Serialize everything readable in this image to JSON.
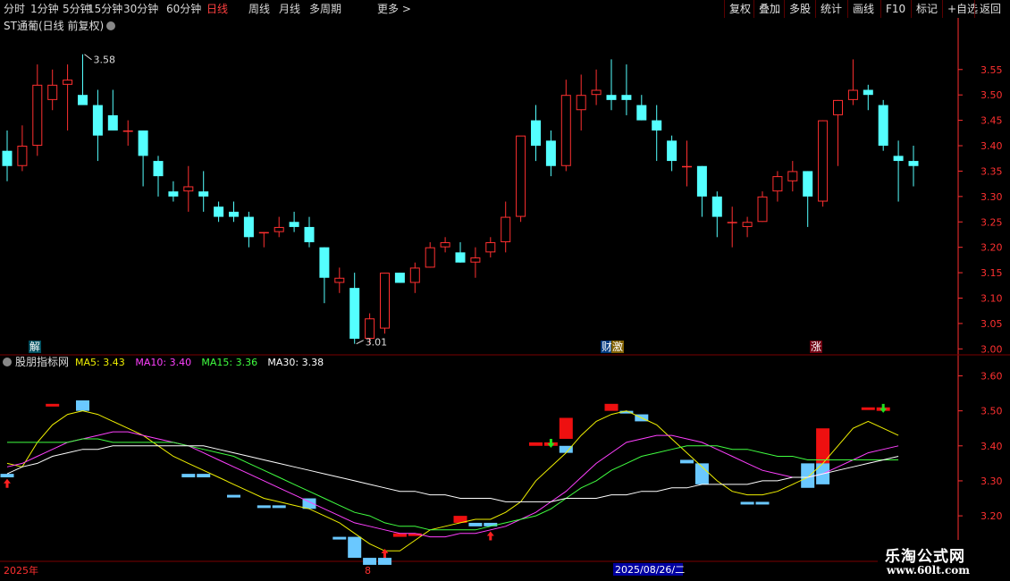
{
  "toolbar": {
    "periods": [
      "分时",
      "1分钟",
      "5分钟",
      "15分钟",
      "30分钟",
      "60分钟",
      "日线",
      "周线",
      "月线",
      "多周期",
      "更多 >"
    ],
    "active_period": "日线",
    "right_buttons": [
      "复权",
      "叠加",
      "多股",
      "统计",
      "画线",
      "F10",
      "标记",
      "+自选",
      "返回"
    ]
  },
  "main_panel": {
    "title": "ST通葡(日线 前复权)",
    "high_label": "3.58",
    "low_label": "3.01",
    "markers": [
      "解",
      "财",
      "激",
      "涨"
    ]
  },
  "indicator_panel": {
    "name": "股朋指标网",
    "ma": [
      {
        "label": "MA5:",
        "value": "3.43",
        "color": "#f0f000"
      },
      {
        "label": "MA10:",
        "value": "3.40",
        "color": "#ff40ff"
      },
      {
        "label": "MA15:",
        "value": "3.36",
        "color": "#40ff40"
      },
      {
        "label": "MA30:",
        "value": "3.38",
        "color": "#ffffff"
      }
    ]
  },
  "bottom_bar": {
    "left_label": "2025年",
    "month_label": "8",
    "date_label": "2025/08/26/二"
  },
  "watermark": {
    "title": "乐淘公式网",
    "url": "www.60lt.com"
  },
  "colors": {
    "up": "#ff3030",
    "down": "#54ffff",
    "grid": "#7a0000",
    "axis": "#ff3030"
  },
  "chart_data": [
    {
      "type": "candlestick",
      "title": "ST通葡(日线 前复权)",
      "ylim": [
        2.99,
        3.62
      ],
      "yticks": [
        3.0,
        3.05,
        3.1,
        3.15,
        3.2,
        3.25,
        3.3,
        3.35,
        3.4,
        3.45,
        3.5,
        3.55
      ],
      "annotations": [
        {
          "label": "3.58",
          "value": 3.58
        },
        {
          "label": "3.01",
          "value": 3.01
        }
      ],
      "ohlc": [
        [
          3.39,
          3.43,
          3.33,
          3.36
        ],
        [
          3.36,
          3.44,
          3.35,
          3.4
        ],
        [
          3.4,
          3.56,
          3.38,
          3.52
        ],
        [
          3.49,
          3.55,
          3.47,
          3.52
        ],
        [
          3.52,
          3.56,
          3.43,
          3.53
        ],
        [
          3.5,
          3.58,
          3.48,
          3.48
        ],
        [
          3.48,
          3.51,
          3.37,
          3.42
        ],
        [
          3.46,
          3.51,
          3.43,
          3.43
        ],
        [
          3.43,
          3.45,
          3.4,
          3.43
        ],
        [
          3.43,
          3.43,
          3.32,
          3.38
        ],
        [
          3.37,
          3.38,
          3.3,
          3.34
        ],
        [
          3.31,
          3.33,
          3.29,
          3.3
        ],
        [
          3.31,
          3.36,
          3.27,
          3.32
        ],
        [
          3.31,
          3.35,
          3.27,
          3.3
        ],
        [
          3.28,
          3.29,
          3.25,
          3.26
        ],
        [
          3.27,
          3.29,
          3.25,
          3.26
        ],
        [
          3.26,
          3.27,
          3.2,
          3.22
        ],
        [
          3.23,
          3.23,
          3.2,
          3.23
        ],
        [
          3.23,
          3.26,
          3.22,
          3.24
        ],
        [
          3.25,
          3.27,
          3.23,
          3.24
        ],
        [
          3.24,
          3.26,
          3.2,
          3.21
        ],
        [
          3.2,
          3.2,
          3.09,
          3.14
        ],
        [
          3.13,
          3.16,
          3.11,
          3.14
        ],
        [
          3.12,
          3.15,
          3.01,
          3.02
        ],
        [
          3.02,
          3.07,
          3.01,
          3.06
        ],
        [
          3.04,
          3.15,
          3.03,
          3.15
        ],
        [
          3.15,
          3.15,
          3.13,
          3.13
        ],
        [
          3.13,
          3.17,
          3.11,
          3.16
        ],
        [
          3.16,
          3.21,
          3.16,
          3.2
        ],
        [
          3.2,
          3.22,
          3.19,
          3.21
        ],
        [
          3.19,
          3.21,
          3.17,
          3.17
        ],
        [
          3.17,
          3.2,
          3.14,
          3.18
        ],
        [
          3.19,
          3.22,
          3.18,
          3.21
        ],
        [
          3.21,
          3.29,
          3.19,
          3.26
        ],
        [
          3.26,
          3.41,
          3.25,
          3.42
        ],
        [
          3.45,
          3.48,
          3.37,
          3.4
        ],
        [
          3.41,
          3.43,
          3.34,
          3.36
        ],
        [
          3.36,
          3.53,
          3.35,
          3.5
        ],
        [
          3.47,
          3.54,
          3.43,
          3.5
        ],
        [
          3.5,
          3.55,
          3.48,
          3.51
        ],
        [
          3.5,
          3.57,
          3.47,
          3.49
        ],
        [
          3.5,
          3.56,
          3.46,
          3.49
        ],
        [
          3.48,
          3.5,
          3.45,
          3.45
        ],
        [
          3.45,
          3.48,
          3.37,
          3.43
        ],
        [
          3.41,
          3.42,
          3.35,
          3.37
        ],
        [
          3.36,
          3.41,
          3.32,
          3.36
        ],
        [
          3.36,
          3.36,
          3.26,
          3.3
        ],
        [
          3.3,
          3.31,
          3.22,
          3.26
        ],
        [
          3.25,
          3.28,
          3.2,
          3.25
        ],
        [
          3.24,
          3.26,
          3.22,
          3.25
        ],
        [
          3.25,
          3.31,
          3.25,
          3.3
        ],
        [
          3.31,
          3.35,
          3.29,
          3.34
        ],
        [
          3.33,
          3.37,
          3.31,
          3.35
        ],
        [
          3.35,
          3.35,
          3.24,
          3.3
        ],
        [
          3.29,
          3.45,
          3.28,
          3.45
        ],
        [
          3.46,
          3.49,
          3.36,
          3.49
        ],
        [
          3.49,
          3.57,
          3.48,
          3.51
        ],
        [
          3.51,
          3.52,
          3.47,
          3.5
        ],
        [
          3.48,
          3.49,
          3.39,
          3.4
        ],
        [
          3.38,
          3.41,
          3.29,
          3.37
        ],
        [
          3.37,
          3.4,
          3.32,
          3.36
        ]
      ]
    },
    {
      "type": "line",
      "name": "股朋指标网",
      "ylim": [
        3.07,
        3.66
      ],
      "yticks": [
        3.1,
        3.2,
        3.3,
        3.4,
        3.5,
        3.6
      ],
      "series": [
        {
          "name": "MA5",
          "color": "#f0f000",
          "values": [
            3.35,
            3.34,
            3.41,
            3.46,
            3.49,
            3.5,
            3.49,
            3.47,
            3.45,
            3.43,
            3.4,
            3.37,
            3.35,
            3.33,
            3.31,
            3.29,
            3.27,
            3.25,
            3.24,
            3.23,
            3.22,
            3.2,
            3.18,
            3.15,
            3.12,
            3.1,
            3.1,
            3.13,
            3.16,
            3.17,
            3.18,
            3.19,
            3.19,
            3.21,
            3.24,
            3.3,
            3.34,
            3.38,
            3.43,
            3.47,
            3.49,
            3.5,
            3.48,
            3.46,
            3.42,
            3.38,
            3.34,
            3.3,
            3.27,
            3.26,
            3.26,
            3.27,
            3.29,
            3.31,
            3.35,
            3.4,
            3.45,
            3.47,
            3.45,
            3.43
          ]
        },
        {
          "name": "MA10",
          "color": "#ff40ff",
          "values": [
            3.34,
            3.35,
            3.37,
            3.39,
            3.41,
            3.42,
            3.43,
            3.44,
            3.44,
            3.43,
            3.42,
            3.41,
            3.4,
            3.38,
            3.36,
            3.34,
            3.32,
            3.3,
            3.28,
            3.26,
            3.24,
            3.22,
            3.2,
            3.18,
            3.17,
            3.16,
            3.15,
            3.15,
            3.14,
            3.14,
            3.15,
            3.15,
            3.16,
            3.17,
            3.19,
            3.21,
            3.24,
            3.27,
            3.31,
            3.35,
            3.38,
            3.41,
            3.42,
            3.43,
            3.43,
            3.42,
            3.41,
            3.39,
            3.37,
            3.35,
            3.33,
            3.32,
            3.31,
            3.31,
            3.32,
            3.34,
            3.36,
            3.38,
            3.39,
            3.4
          ]
        },
        {
          "name": "MA15",
          "color": "#40ff40",
          "values": [
            3.41,
            3.41,
            3.41,
            3.41,
            3.41,
            3.42,
            3.42,
            3.41,
            3.41,
            3.41,
            3.41,
            3.41,
            3.4,
            3.39,
            3.38,
            3.37,
            3.35,
            3.33,
            3.31,
            3.29,
            3.27,
            3.25,
            3.23,
            3.21,
            3.2,
            3.18,
            3.17,
            3.17,
            3.16,
            3.16,
            3.16,
            3.16,
            3.17,
            3.18,
            3.19,
            3.2,
            3.22,
            3.25,
            3.28,
            3.3,
            3.33,
            3.35,
            3.37,
            3.38,
            3.39,
            3.4,
            3.4,
            3.4,
            3.39,
            3.39,
            3.38,
            3.37,
            3.37,
            3.36,
            3.36,
            3.36,
            3.36,
            3.36,
            3.36,
            3.36
          ]
        },
        {
          "name": "MA30",
          "color": "#ffffff",
          "values": [
            3.32,
            3.34,
            3.35,
            3.37,
            3.38,
            3.39,
            3.39,
            3.4,
            3.4,
            3.4,
            3.4,
            3.4,
            3.4,
            3.4,
            3.39,
            3.38,
            3.37,
            3.36,
            3.35,
            3.34,
            3.33,
            3.32,
            3.31,
            3.3,
            3.29,
            3.28,
            3.27,
            3.27,
            3.26,
            3.26,
            3.25,
            3.25,
            3.25,
            3.24,
            3.24,
            3.24,
            3.24,
            3.25,
            3.25,
            3.25,
            3.26,
            3.26,
            3.27,
            3.27,
            3.28,
            3.28,
            3.29,
            3.29,
            3.29,
            3.29,
            3.3,
            3.3,
            3.31,
            3.31,
            3.32,
            3.33,
            3.34,
            3.35,
            3.36,
            3.37
          ]
        }
      ],
      "bars": [
        [
          0,
          3.32,
          3.31,
          "d"
        ],
        [
          3,
          3.52,
          3.52,
          "u"
        ],
        [
          5,
          3.53,
          3.5,
          "d"
        ],
        [
          12,
          3.32,
          3.31,
          "d"
        ],
        [
          13,
          3.32,
          3.31,
          "d"
        ],
        [
          15,
          3.26,
          3.26,
          "d"
        ],
        [
          17,
          3.23,
          3.23,
          "d"
        ],
        [
          18,
          3.23,
          3.23,
          "d"
        ],
        [
          20,
          3.25,
          3.22,
          "d"
        ],
        [
          22,
          3.14,
          3.14,
          "d"
        ],
        [
          23,
          3.14,
          3.08,
          "d"
        ],
        [
          24,
          3.08,
          3.06,
          "d"
        ],
        [
          25,
          3.08,
          3.06,
          "d"
        ],
        [
          26,
          3.15,
          3.14,
          "u"
        ],
        [
          27,
          3.15,
          3.15,
          "u"
        ],
        [
          30,
          3.2,
          3.18,
          "u"
        ],
        [
          31,
          3.18,
          3.17,
          "d"
        ],
        [
          32,
          3.18,
          3.17,
          "d"
        ],
        [
          35,
          3.41,
          3.4,
          "u"
        ],
        [
          36,
          3.41,
          3.4,
          "u"
        ],
        [
          37,
          3.48,
          3.42,
          "u"
        ],
        [
          37,
          3.4,
          3.38,
          "d"
        ],
        [
          40,
          3.52,
          3.5,
          "u"
        ],
        [
          41,
          3.5,
          3.5,
          "d"
        ],
        [
          42,
          3.49,
          3.47,
          "d"
        ],
        [
          45,
          3.36,
          3.35,
          "d"
        ],
        [
          46,
          3.35,
          3.29,
          "d"
        ],
        [
          49,
          3.24,
          3.24,
          "d"
        ],
        [
          50,
          3.24,
          3.24,
          "d"
        ],
        [
          53,
          3.35,
          3.28,
          "d"
        ],
        [
          54,
          3.45,
          3.35,
          "u"
        ],
        [
          54,
          3.35,
          3.29,
          "d"
        ],
        [
          57,
          3.51,
          3.51,
          "u"
        ],
        [
          58,
          3.51,
          3.5,
          "u"
        ]
      ],
      "signals": [
        [
          0,
          "up"
        ],
        [
          25,
          "up"
        ],
        [
          32,
          "up"
        ],
        [
          36,
          "down"
        ],
        [
          58,
          "down"
        ]
      ]
    }
  ]
}
